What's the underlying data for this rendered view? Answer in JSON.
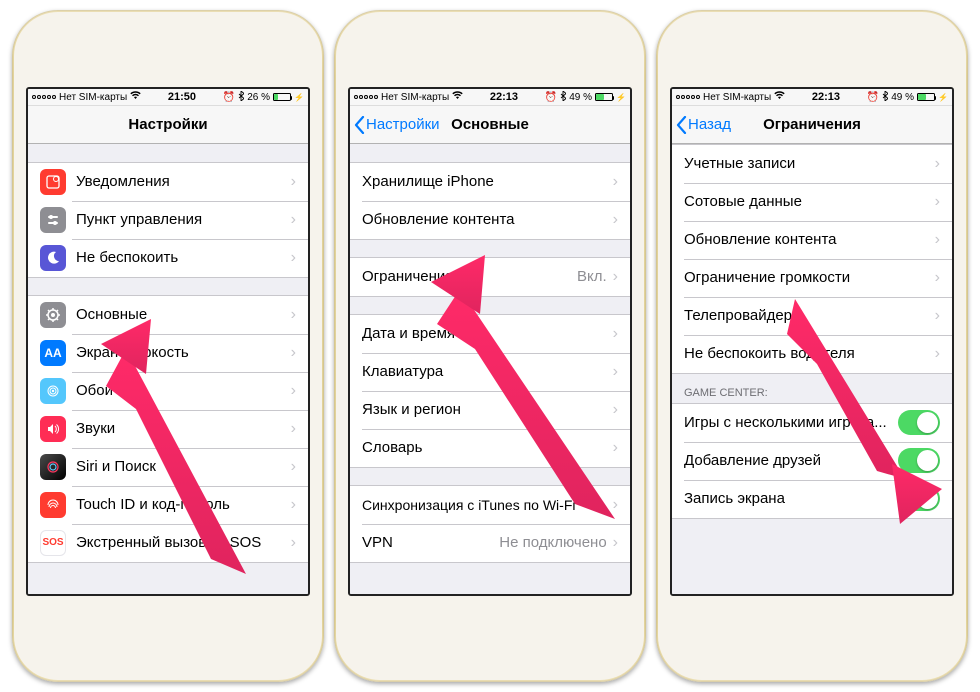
{
  "status": {
    "carrier": "Нет SIM-карты",
    "time1": "21:50",
    "time2": "22:13",
    "time3": "22:13",
    "bt_pct1": "26 %",
    "bt_pct2": "49 %",
    "bt_pct3": "49 %"
  },
  "screen1": {
    "title": "Настройки",
    "group1": [
      {
        "icon": "notifications",
        "color": "#ff3b30",
        "label": "Уведомления"
      },
      {
        "icon": "control",
        "color": "#8e8e93",
        "label": "Пункт управления"
      },
      {
        "icon": "dnd",
        "color": "#5856d6",
        "label": "Не беспокоить"
      }
    ],
    "group2": [
      {
        "icon": "general",
        "color": "#8e8e93",
        "label": "Основные"
      },
      {
        "icon": "display",
        "color": "#007aff",
        "label": "Экран и яркость"
      },
      {
        "icon": "wallpaper",
        "color": "#54c7fc",
        "label": "Обои"
      },
      {
        "icon": "sounds",
        "color": "#ff2d55",
        "label": "Звуки"
      },
      {
        "icon": "siri",
        "color": "#000",
        "label": "Siri и Поиск"
      },
      {
        "icon": "touchid",
        "color": "#ff3b30",
        "label": "Touch ID и код-пароль"
      },
      {
        "icon": "sos",
        "color": "#fff",
        "label": "Экстренный вызов — SOS"
      }
    ]
  },
  "screen2": {
    "back": "Настройки",
    "title": "Основные",
    "group1": [
      {
        "label": "Хранилище iPhone"
      },
      {
        "label": "Обновление контента"
      }
    ],
    "group2": [
      {
        "label": "Ограничения",
        "value": "Вкл."
      }
    ],
    "group3": [
      {
        "label": "Дата и время"
      },
      {
        "label": "Клавиатура"
      },
      {
        "label": "Язык и регион"
      },
      {
        "label": "Словарь"
      }
    ],
    "group4": [
      {
        "label": "Синхронизация с iTunes по Wi-Fi"
      },
      {
        "label": "VPN",
        "value": "Не подключено"
      }
    ]
  },
  "screen3": {
    "back": "Назад",
    "title": "Ограничения",
    "group1": [
      {
        "label": "Учетные записи"
      },
      {
        "label": "Сотовые данные"
      },
      {
        "label": "Обновление контента"
      },
      {
        "label": "Ограничение громкости"
      },
      {
        "label": "Телепровайдер"
      },
      {
        "label": "Не беспокоить водителя"
      }
    ],
    "gc_header": "GAME CENTER:",
    "gc": [
      {
        "label": "Игры с несколькими игрока..."
      },
      {
        "label": "Добавление друзей"
      },
      {
        "label": "Запись экрана"
      }
    ]
  }
}
